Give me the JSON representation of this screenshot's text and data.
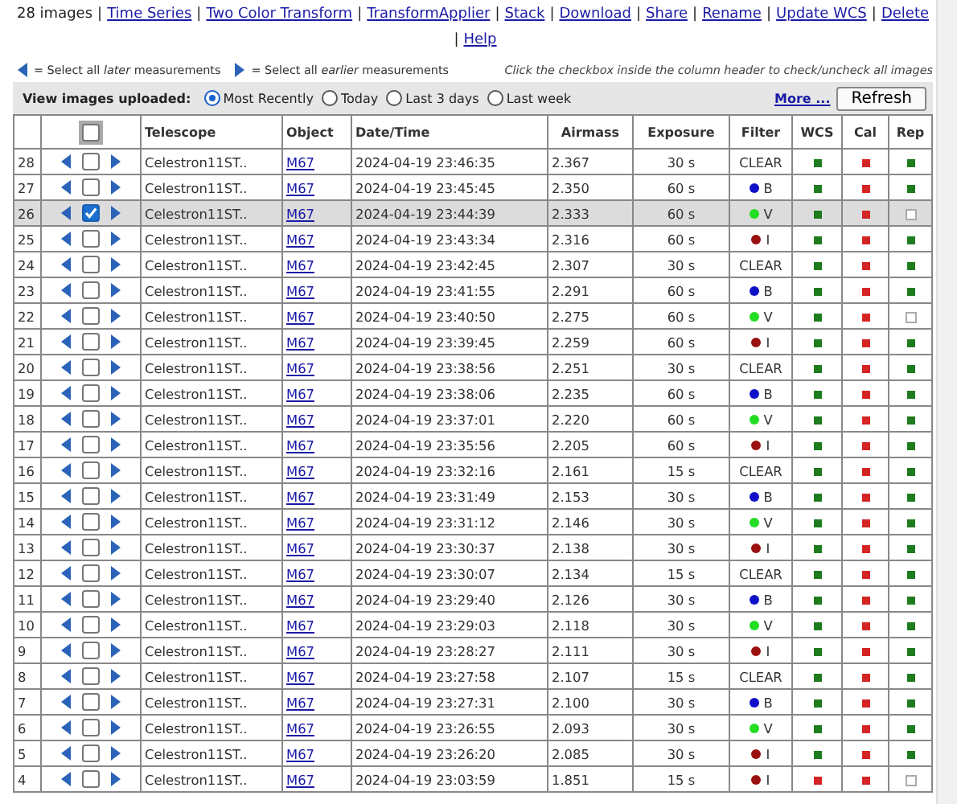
{
  "header": {
    "count": "28 images",
    "separator": "|",
    "links": [
      "Time Series",
      "Two Color Transform",
      "TransformApplier",
      "Stack",
      "Download",
      "Share",
      "Rename",
      "Update WCS",
      "Delete",
      "Help"
    ]
  },
  "legend": {
    "later_before": "= Select all ",
    "later_em": "later",
    "later_after": " measurements",
    "earlier_before": "= Select all ",
    "earlier_em": "earlier",
    "earlier_after": " measurements",
    "hint": "Click the checkbox inside the column header to check/uncheck all images"
  },
  "view": {
    "label": "View images uploaded:",
    "options": [
      {
        "label": "Most Recently",
        "selected": true
      },
      {
        "label": "Today",
        "selected": false
      },
      {
        "label": "Last 3 days",
        "selected": false
      },
      {
        "label": "Last week",
        "selected": false
      }
    ],
    "more": "More ...",
    "refresh": "Refresh"
  },
  "table": {
    "header_checkbox": {
      "checked": false
    },
    "columns": [
      "Telescope",
      "Object",
      "Date/Time",
      "Airmass",
      "Exposure",
      "Filter",
      "WCS",
      "Cal",
      "Rep"
    ],
    "rows": [
      {
        "num": "28",
        "checked": false,
        "telescope": "Celestron11ST..",
        "object": "M67",
        "datetime": "2024-04-19 23:46:35",
        "airmass": "2.367",
        "exposure": "30 s",
        "filter": {
          "name": "CLEAR"
        },
        "wcs": {
          "filled": true,
          "color": "#1e7b1e"
        },
        "cal": {
          "filled": true,
          "color": "#d42424"
        },
        "rep": {
          "filled": true,
          "color": "#1e7b1e"
        }
      },
      {
        "num": "27",
        "checked": false,
        "telescope": "Celestron11ST..",
        "object": "M67",
        "datetime": "2024-04-19 23:45:45",
        "airmass": "2.350",
        "exposure": "60 s",
        "filter": {
          "name": "B",
          "color": "#1010c8"
        },
        "wcs": {
          "filled": true,
          "color": "#1e7b1e"
        },
        "cal": {
          "filled": true,
          "color": "#d42424"
        },
        "rep": {
          "filled": true,
          "color": "#1e7b1e"
        }
      },
      {
        "num": "26",
        "checked": true,
        "telescope": "Celestron11ST..",
        "object": "M67",
        "datetime": "2024-04-19 23:44:39",
        "airmass": "2.333",
        "exposure": "60 s",
        "filter": {
          "name": "V",
          "color": "#22dd22"
        },
        "wcs": {
          "filled": true,
          "color": "#1e7b1e"
        },
        "cal": {
          "filled": true,
          "color": "#d42424"
        },
        "rep": {
          "filled": false
        }
      },
      {
        "num": "25",
        "checked": false,
        "telescope": "Celestron11ST..",
        "object": "M67",
        "datetime": "2024-04-19 23:43:34",
        "airmass": "2.316",
        "exposure": "60 s",
        "filter": {
          "name": "I",
          "color": "#9a1010"
        },
        "wcs": {
          "filled": true,
          "color": "#1e7b1e"
        },
        "cal": {
          "filled": true,
          "color": "#d42424"
        },
        "rep": {
          "filled": true,
          "color": "#1e7b1e"
        }
      },
      {
        "num": "24",
        "checked": false,
        "telescope": "Celestron11ST..",
        "object": "M67",
        "datetime": "2024-04-19 23:42:45",
        "airmass": "2.307",
        "exposure": "30 s",
        "filter": {
          "name": "CLEAR"
        },
        "wcs": {
          "filled": true,
          "color": "#1e7b1e"
        },
        "cal": {
          "filled": true,
          "color": "#d42424"
        },
        "rep": {
          "filled": true,
          "color": "#1e7b1e"
        }
      },
      {
        "num": "23",
        "checked": false,
        "telescope": "Celestron11ST..",
        "object": "M67",
        "datetime": "2024-04-19 23:41:55",
        "airmass": "2.291",
        "exposure": "60 s",
        "filter": {
          "name": "B",
          "color": "#1010c8"
        },
        "wcs": {
          "filled": true,
          "color": "#1e7b1e"
        },
        "cal": {
          "filled": true,
          "color": "#d42424"
        },
        "rep": {
          "filled": true,
          "color": "#1e7b1e"
        }
      },
      {
        "num": "22",
        "checked": false,
        "telescope": "Celestron11ST..",
        "object": "M67",
        "datetime": "2024-04-19 23:40:50",
        "airmass": "2.275",
        "exposure": "60 s",
        "filter": {
          "name": "V",
          "color": "#22dd22"
        },
        "wcs": {
          "filled": true,
          "color": "#1e7b1e"
        },
        "cal": {
          "filled": true,
          "color": "#d42424"
        },
        "rep": {
          "filled": false
        }
      },
      {
        "num": "21",
        "checked": false,
        "telescope": "Celestron11ST..",
        "object": "M67",
        "datetime": "2024-04-19 23:39:45",
        "airmass": "2.259",
        "exposure": "60 s",
        "filter": {
          "name": "I",
          "color": "#9a1010"
        },
        "wcs": {
          "filled": true,
          "color": "#1e7b1e"
        },
        "cal": {
          "filled": true,
          "color": "#d42424"
        },
        "rep": {
          "filled": true,
          "color": "#1e7b1e"
        }
      },
      {
        "num": "20",
        "checked": false,
        "telescope": "Celestron11ST..",
        "object": "M67",
        "datetime": "2024-04-19 23:38:56",
        "airmass": "2.251",
        "exposure": "30 s",
        "filter": {
          "name": "CLEAR"
        },
        "wcs": {
          "filled": true,
          "color": "#1e7b1e"
        },
        "cal": {
          "filled": true,
          "color": "#d42424"
        },
        "rep": {
          "filled": true,
          "color": "#1e7b1e"
        }
      },
      {
        "num": "19",
        "checked": false,
        "telescope": "Celestron11ST..",
        "object": "M67",
        "datetime": "2024-04-19 23:38:06",
        "airmass": "2.235",
        "exposure": "60 s",
        "filter": {
          "name": "B",
          "color": "#1010c8"
        },
        "wcs": {
          "filled": true,
          "color": "#1e7b1e"
        },
        "cal": {
          "filled": true,
          "color": "#d42424"
        },
        "rep": {
          "filled": true,
          "color": "#1e7b1e"
        }
      },
      {
        "num": "18",
        "checked": false,
        "telescope": "Celestron11ST..",
        "object": "M67",
        "datetime": "2024-04-19 23:37:01",
        "airmass": "2.220",
        "exposure": "60 s",
        "filter": {
          "name": "V",
          "color": "#22dd22"
        },
        "wcs": {
          "filled": true,
          "color": "#1e7b1e"
        },
        "cal": {
          "filled": true,
          "color": "#d42424"
        },
        "rep": {
          "filled": true,
          "color": "#1e7b1e"
        }
      },
      {
        "num": "17",
        "checked": false,
        "telescope": "Celestron11ST..",
        "object": "M67",
        "datetime": "2024-04-19 23:35:56",
        "airmass": "2.205",
        "exposure": "60 s",
        "filter": {
          "name": "I",
          "color": "#9a1010"
        },
        "wcs": {
          "filled": true,
          "color": "#1e7b1e"
        },
        "cal": {
          "filled": true,
          "color": "#d42424"
        },
        "rep": {
          "filled": true,
          "color": "#1e7b1e"
        }
      },
      {
        "num": "16",
        "checked": false,
        "telescope": "Celestron11ST..",
        "object": "M67",
        "datetime": "2024-04-19 23:32:16",
        "airmass": "2.161",
        "exposure": "15 s",
        "filter": {
          "name": "CLEAR"
        },
        "wcs": {
          "filled": true,
          "color": "#1e7b1e"
        },
        "cal": {
          "filled": true,
          "color": "#d42424"
        },
        "rep": {
          "filled": true,
          "color": "#1e7b1e"
        }
      },
      {
        "num": "15",
        "checked": false,
        "telescope": "Celestron11ST..",
        "object": "M67",
        "datetime": "2024-04-19 23:31:49",
        "airmass": "2.153",
        "exposure": "30 s",
        "filter": {
          "name": "B",
          "color": "#1010c8"
        },
        "wcs": {
          "filled": true,
          "color": "#1e7b1e"
        },
        "cal": {
          "filled": true,
          "color": "#d42424"
        },
        "rep": {
          "filled": true,
          "color": "#1e7b1e"
        }
      },
      {
        "num": "14",
        "checked": false,
        "telescope": "Celestron11ST..",
        "object": "M67",
        "datetime": "2024-04-19 23:31:12",
        "airmass": "2.146",
        "exposure": "30 s",
        "filter": {
          "name": "V",
          "color": "#22dd22"
        },
        "wcs": {
          "filled": true,
          "color": "#1e7b1e"
        },
        "cal": {
          "filled": true,
          "color": "#d42424"
        },
        "rep": {
          "filled": true,
          "color": "#1e7b1e"
        }
      },
      {
        "num": "13",
        "checked": false,
        "telescope": "Celestron11ST..",
        "object": "M67",
        "datetime": "2024-04-19 23:30:37",
        "airmass": "2.138",
        "exposure": "30 s",
        "filter": {
          "name": "I",
          "color": "#9a1010"
        },
        "wcs": {
          "filled": true,
          "color": "#1e7b1e"
        },
        "cal": {
          "filled": true,
          "color": "#d42424"
        },
        "rep": {
          "filled": true,
          "color": "#1e7b1e"
        }
      },
      {
        "num": "12",
        "checked": false,
        "telescope": "Celestron11ST..",
        "object": "M67",
        "datetime": "2024-04-19 23:30:07",
        "airmass": "2.134",
        "exposure": "15 s",
        "filter": {
          "name": "CLEAR"
        },
        "wcs": {
          "filled": true,
          "color": "#1e7b1e"
        },
        "cal": {
          "filled": true,
          "color": "#d42424"
        },
        "rep": {
          "filled": true,
          "color": "#1e7b1e"
        }
      },
      {
        "num": "11",
        "checked": false,
        "telescope": "Celestron11ST..",
        "object": "M67",
        "datetime": "2024-04-19 23:29:40",
        "airmass": "2.126",
        "exposure": "30 s",
        "filter": {
          "name": "B",
          "color": "#1010c8"
        },
        "wcs": {
          "filled": true,
          "color": "#1e7b1e"
        },
        "cal": {
          "filled": true,
          "color": "#d42424"
        },
        "rep": {
          "filled": true,
          "color": "#1e7b1e"
        }
      },
      {
        "num": "10",
        "checked": false,
        "telescope": "Celestron11ST..",
        "object": "M67",
        "datetime": "2024-04-19 23:29:03",
        "airmass": "2.118",
        "exposure": "30 s",
        "filter": {
          "name": "V",
          "color": "#22dd22"
        },
        "wcs": {
          "filled": true,
          "color": "#1e7b1e"
        },
        "cal": {
          "filled": true,
          "color": "#d42424"
        },
        "rep": {
          "filled": true,
          "color": "#1e7b1e"
        }
      },
      {
        "num": "9",
        "checked": false,
        "telescope": "Celestron11ST..",
        "object": "M67",
        "datetime": "2024-04-19 23:28:27",
        "airmass": "2.111",
        "exposure": "30 s",
        "filter": {
          "name": "I",
          "color": "#9a1010"
        },
        "wcs": {
          "filled": true,
          "color": "#1e7b1e"
        },
        "cal": {
          "filled": true,
          "color": "#d42424"
        },
        "rep": {
          "filled": true,
          "color": "#1e7b1e"
        }
      },
      {
        "num": "8",
        "checked": false,
        "telescope": "Celestron11ST..",
        "object": "M67",
        "datetime": "2024-04-19 23:27:58",
        "airmass": "2.107",
        "exposure": "15 s",
        "filter": {
          "name": "CLEAR"
        },
        "wcs": {
          "filled": true,
          "color": "#1e7b1e"
        },
        "cal": {
          "filled": true,
          "color": "#d42424"
        },
        "rep": {
          "filled": true,
          "color": "#1e7b1e"
        }
      },
      {
        "num": "7",
        "checked": false,
        "telescope": "Celestron11ST..",
        "object": "M67",
        "datetime": "2024-04-19 23:27:31",
        "airmass": "2.100",
        "exposure": "30 s",
        "filter": {
          "name": "B",
          "color": "#1010c8"
        },
        "wcs": {
          "filled": true,
          "color": "#1e7b1e"
        },
        "cal": {
          "filled": true,
          "color": "#d42424"
        },
        "rep": {
          "filled": true,
          "color": "#1e7b1e"
        }
      },
      {
        "num": "6",
        "checked": false,
        "telescope": "Celestron11ST..",
        "object": "M67",
        "datetime": "2024-04-19 23:26:55",
        "airmass": "2.093",
        "exposure": "30 s",
        "filter": {
          "name": "V",
          "color": "#22dd22"
        },
        "wcs": {
          "filled": true,
          "color": "#1e7b1e"
        },
        "cal": {
          "filled": true,
          "color": "#d42424"
        },
        "rep": {
          "filled": true,
          "color": "#1e7b1e"
        }
      },
      {
        "num": "5",
        "checked": false,
        "telescope": "Celestron11ST..",
        "object": "M67",
        "datetime": "2024-04-19 23:26:20",
        "airmass": "2.085",
        "exposure": "30 s",
        "filter": {
          "name": "I",
          "color": "#9a1010"
        },
        "wcs": {
          "filled": true,
          "color": "#1e7b1e"
        },
        "cal": {
          "filled": true,
          "color": "#d42424"
        },
        "rep": {
          "filled": true,
          "color": "#1e7b1e"
        }
      },
      {
        "num": "4",
        "checked": false,
        "telescope": "Celestron11ST..",
        "object": "M67",
        "datetime": "2024-04-19 23:03:59",
        "airmass": "1.851",
        "exposure": "15 s",
        "filter": {
          "name": "I",
          "color": "#9a1010"
        },
        "wcs": {
          "filled": true,
          "color": "#d42424"
        },
        "cal": {
          "filled": true,
          "color": "#d42424"
        },
        "rep": {
          "filled": false
        }
      }
    ]
  }
}
